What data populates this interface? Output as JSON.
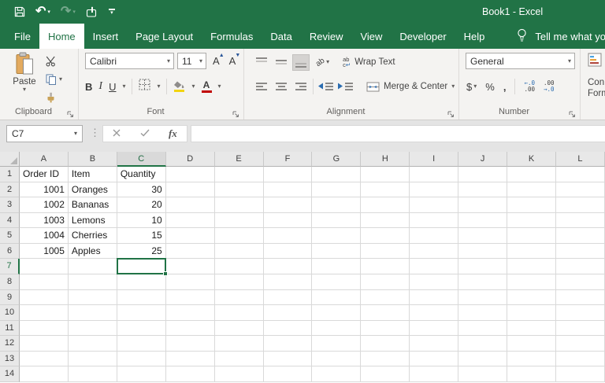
{
  "colors": {
    "excel_green": "#217346",
    "active_tab_text": "#217346",
    "fill_color_swatch": "#f2d411",
    "font_color_swatch": "#c00000",
    "grid_line": "#d9d9d9",
    "selection_border": "#217346"
  },
  "titlebar": {
    "title": "Book1 - Excel"
  },
  "tabs": [
    {
      "label": "File",
      "active": false
    },
    {
      "label": "Home",
      "active": true
    },
    {
      "label": "Insert",
      "active": false
    },
    {
      "label": "Page Layout",
      "active": false
    },
    {
      "label": "Formulas",
      "active": false
    },
    {
      "label": "Data",
      "active": false
    },
    {
      "label": "Review",
      "active": false
    },
    {
      "label": "View",
      "active": false
    },
    {
      "label": "Developer",
      "active": false
    },
    {
      "label": "Help",
      "active": false
    }
  ],
  "tell_me": {
    "label": "Tell me what you wan"
  },
  "ribbon": {
    "clipboard": {
      "paste_label": "Paste",
      "group_label": "Clipboard"
    },
    "font": {
      "font_name": "Calibri",
      "font_size": "11",
      "bold": "B",
      "italic": "I",
      "underline": "U",
      "group_label": "Font"
    },
    "alignment": {
      "orientation_glyph": "ab",
      "wrap_icon_top": "ab",
      "wrap_icon_bottom": "c",
      "wrap_text_label": "Wrap Text",
      "merge_center_label": "Merge & Center",
      "group_label": "Alignment"
    },
    "number": {
      "format": "General",
      "currency": "$",
      "percent": "%",
      "comma": ",",
      "increase_decimal_glyph": [
        "←.0",
        ".00"
      ],
      "decrease_decimal_glyph": [
        ".00",
        "→.0"
      ],
      "group_label": "Number"
    },
    "styles": {
      "label_line1": "Con",
      "label_line2": "Form"
    }
  },
  "formula_bar": {
    "name_box": "C7",
    "fx_label": "fx",
    "formula_value": ""
  },
  "grid": {
    "columns": [
      "A",
      "B",
      "C",
      "D",
      "E",
      "F",
      "G",
      "H",
      "I",
      "J",
      "K",
      "L"
    ],
    "rows": [
      1,
      2,
      3,
      4,
      5,
      6,
      7,
      8,
      9,
      10,
      11,
      12,
      13,
      14
    ],
    "selected": {
      "cell": "C7",
      "column": "C",
      "row": 7
    },
    "cells": {
      "A1": {
        "value": "Order ID",
        "align": "left"
      },
      "B1": {
        "value": "Item",
        "align": "left"
      },
      "C1": {
        "value": "Quantity",
        "align": "left"
      },
      "A2": {
        "value": "1001",
        "align": "right"
      },
      "B2": {
        "value": "Oranges",
        "align": "left"
      },
      "C2": {
        "value": "30",
        "align": "right"
      },
      "A3": {
        "value": "1002",
        "align": "right"
      },
      "B3": {
        "value": "Bananas",
        "align": "left"
      },
      "C3": {
        "value": "20",
        "align": "right"
      },
      "A4": {
        "value": "1003",
        "align": "right"
      },
      "B4": {
        "value": "Lemons",
        "align": "left"
      },
      "C4": {
        "value": "10",
        "align": "right"
      },
      "A5": {
        "value": "1004",
        "align": "right"
      },
      "B5": {
        "value": "Cherries",
        "align": "left"
      },
      "C5": {
        "value": "15",
        "align": "right"
      },
      "A6": {
        "value": "1005",
        "align": "right"
      },
      "B6": {
        "value": "Apples",
        "align": "left"
      },
      "C6": {
        "value": "25",
        "align": "right"
      }
    }
  }
}
